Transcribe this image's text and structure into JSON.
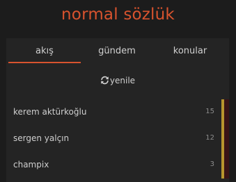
{
  "app": {
    "title": "normal sözlük"
  },
  "tabs": [
    {
      "label": "akış",
      "active": true
    },
    {
      "label": "gündem",
      "active": false
    },
    {
      "label": "konular",
      "active": false
    }
  ],
  "refresh": {
    "label": "yenile",
    "icon": "refresh-icon"
  },
  "topics": [
    {
      "title": "kerem aktürkoğlu",
      "count": "15"
    },
    {
      "title": "sergen yalçın",
      "count": "12"
    },
    {
      "title": "champix",
      "count": "3"
    }
  ],
  "colors": {
    "accent": "#d8532e",
    "background": "#1c1c1c",
    "panel": "#242424",
    "activity_bar": "#b8952e",
    "activity_bg": "#3a1416"
  }
}
